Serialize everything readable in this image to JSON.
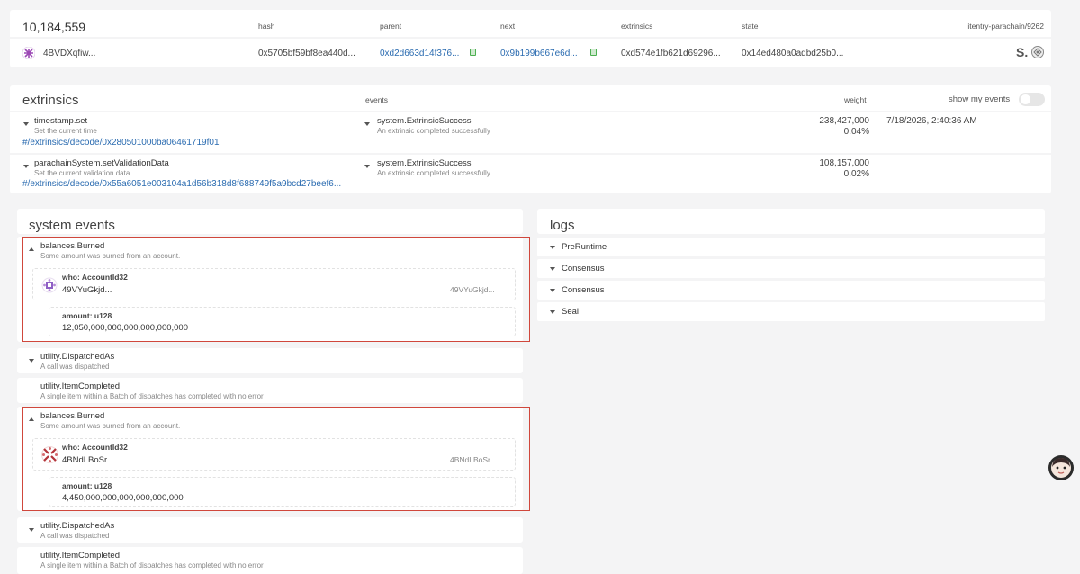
{
  "header": {
    "block_number": "10,184,559",
    "col_hash": "hash",
    "col_parent": "parent",
    "col_next": "next",
    "col_extrinsics": "extrinsics",
    "col_state": "state",
    "chain": "litentry-parachain/9262",
    "author": "4BVDXqfiw...",
    "hash": "0x5705bf59bf8ea440d...",
    "parent": "0xd2d663d14f376...",
    "next": "0x9b199b667e6d...",
    "extrinsics_root": "0xd574e1fb621d69296...",
    "state_root": "0x14ed480a0adbd25b0...",
    "logo_text": "S."
  },
  "extrinsics": {
    "title": "extrinsics",
    "col_events": "events",
    "col_weight": "weight",
    "toggle_label": "show my events",
    "rows": [
      {
        "name": "timestamp.set",
        "desc": "Set the current time",
        "link": "#/extrinsics/decode/0x280501000ba06461719f01",
        "event": "system.ExtrinsicSuccess",
        "event_desc": "An extrinsic completed successfully",
        "weight": "238,427,000",
        "pct": "0.04%",
        "time": "7/18/2026, 2:40:36 AM"
      },
      {
        "name": "parachainSystem.setValidationData",
        "desc": "Set the current validation data",
        "link": "#/extrinsics/decode/0x55a6051e003104a1d56b318d8f688749f5a9bcd27beef6...",
        "event": "system.ExtrinsicSuccess",
        "event_desc": "An extrinsic completed successfully",
        "weight": "108,157,000",
        "pct": "0.02%",
        "time": ""
      }
    ]
  },
  "system_events": {
    "title": "system events",
    "items": [
      {
        "name": "balances.Burned",
        "desc": "Some amount was burned from an account.",
        "who_label": "who: AccountId32",
        "who_value": "49VYuGkjd...",
        "who_short": "49VYuGkjd...",
        "amount_label": "amount: u128",
        "amount_value": "12,050,000,000,000,000,000,000"
      },
      {
        "name": "utility.DispatchedAs",
        "desc": "A call was dispatched"
      },
      {
        "name": "utility.ItemCompleted",
        "desc": "A single item within a Batch of dispatches has completed with no error"
      },
      {
        "name": "balances.Burned",
        "desc": "Some amount was burned from an account.",
        "who_label": "who: AccountId32",
        "who_value": "4BNdLBoSr...",
        "who_short": "4BNdLBoSr...",
        "amount_label": "amount: u128",
        "amount_value": "4,450,000,000,000,000,000,000"
      },
      {
        "name": "utility.DispatchedAs",
        "desc": "A call was dispatched"
      },
      {
        "name": "utility.ItemCompleted",
        "desc": "A single item within a Batch of dispatches has completed with no error"
      }
    ]
  },
  "logs": {
    "title": "logs",
    "items": [
      "PreRuntime",
      "Consensus",
      "Consensus",
      "Seal"
    ]
  },
  "colors": {
    "link": "#2a6bb0",
    "highlight": "#d0473c",
    "copy": "#4caf50"
  }
}
